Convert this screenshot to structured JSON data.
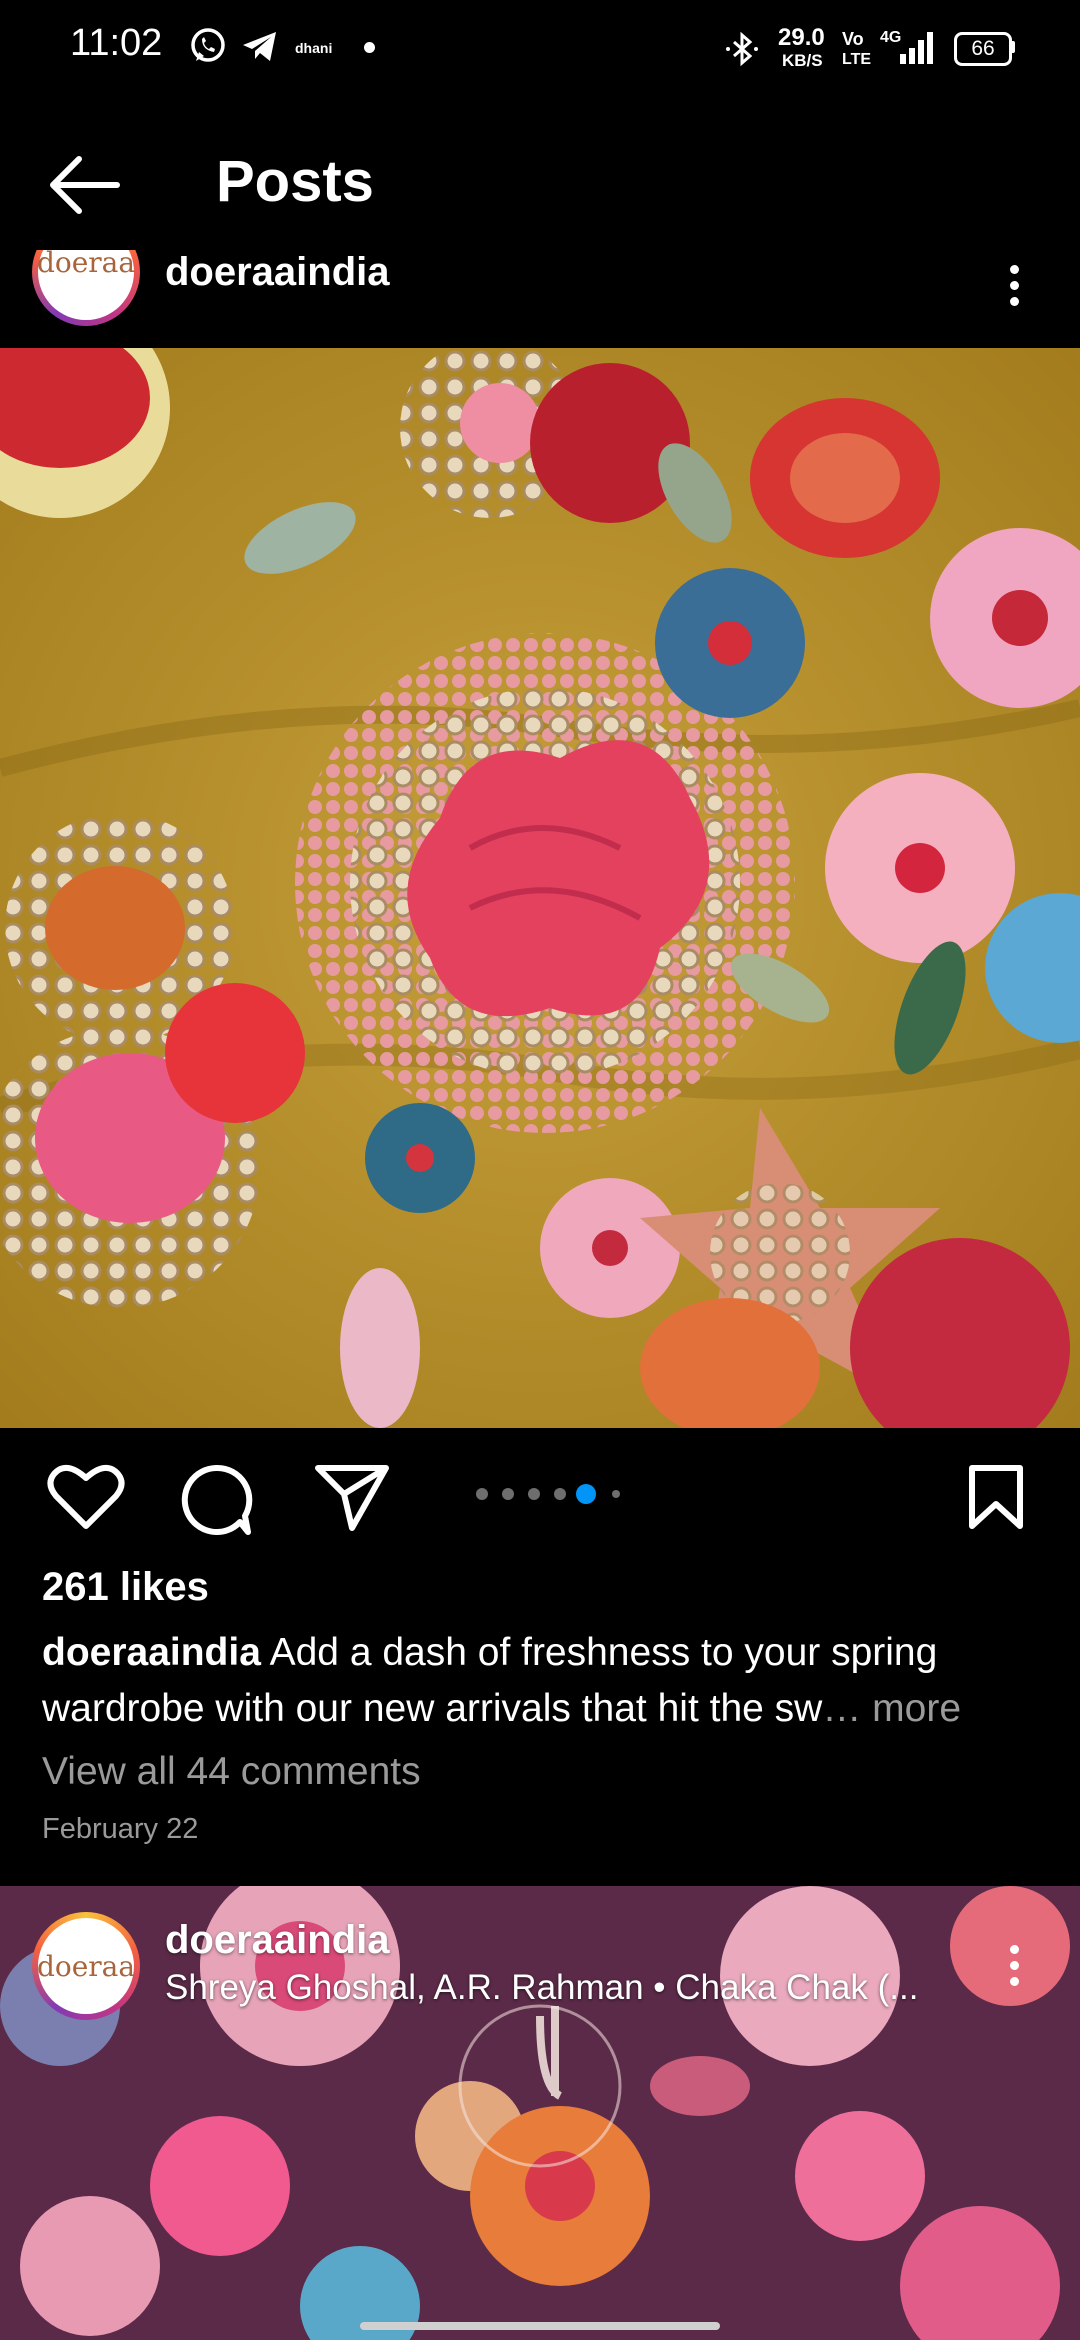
{
  "status_bar": {
    "time": "11:02",
    "notification_icons": [
      "whatsapp-icon",
      "telegram-icon",
      "dhani-icon",
      "dot-icon"
    ],
    "dhani_label": "dhani",
    "net_speed_value": "29.0",
    "net_speed_unit": "KB/S",
    "volte_top": "Vo",
    "volte_bottom": "LTE",
    "network_label": "4G",
    "battery": "66"
  },
  "header": {
    "title": "Posts",
    "back_icon": "arrow-left-icon"
  },
  "post1": {
    "avatar_text": "doeraa",
    "username": "doeraaindia",
    "likes": "261 likes",
    "caption_user": "doeraaindia",
    "caption_text": " Add a dash of freshness to your spring wardrobe with our new arrivals that hit the sw",
    "caption_more": "… more",
    "view_comments": "View all 44 comments",
    "date": "February 22",
    "carousel": {
      "count": 6,
      "active_index": 4
    },
    "colors": {
      "active_dot": "#0095f6",
      "inactive_dot": "#6e6e6e"
    }
  },
  "post2": {
    "avatar_text": "doeraa",
    "username": "doeraaindia",
    "audio": "Shreya Ghoshal, A.R. Rahman • Chaka Chak (..."
  }
}
